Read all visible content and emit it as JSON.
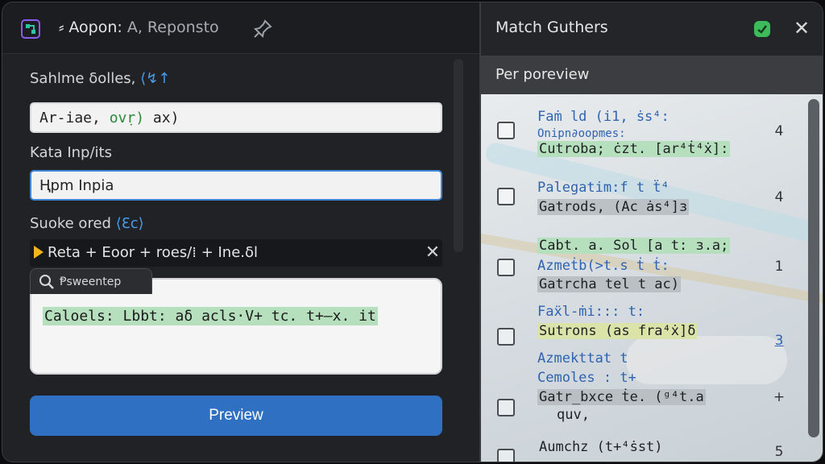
{
  "left": {
    "title": "⸗ Aopon:",
    "title_sub": "A, Reponsto",
    "section1_label": "Sahlme ẟolles,",
    "section1_accent": "⟨↯↑",
    "field1_pre": "Ar-iae,",
    "field1_hl": "ovṛ)",
    "field1_post": "ax)",
    "section2_label": "Kata Inp/its",
    "field2_value": "Ⱨpm Inpia",
    "section3_label": "Suoke ored",
    "section3_accent": "⟨Ɛc⟩",
    "recipe_text": "Reta + Eoor + roes/⁞ + Ine.ẟl",
    "search_label": "Ᵽsweentep",
    "preview_text": "Caloels: Lbbt: aẟ acls·V+ tc. t+–x. it",
    "preview_button": "Preview"
  },
  "right": {
    "title": "Match Guthers",
    "subtitle": "Per poreview",
    "rows": [
      {
        "blue1": "Faṁ ld (i1, ṡs⁴:",
        "blue2": "Onipn∂oopmes:",
        "hl": "Cutroba; ċzt. [ar⁴ṫ⁴ẋ]:",
        "hl_style": "green",
        "count": "4"
      },
      {
        "blue1": "Palegatim:f t ẗ⁴",
        "hl": "Gatrods, (Ac ȧs⁴]ɜ",
        "hl_style": "gray",
        "count": "4"
      },
      {
        "hl_top": "Cabt. a. Sol [a t: ɜ.a;",
        "blue1": "Azmeṫb(>t.s ṫ ṫ:",
        "hl": "Gatrcha tel t ac)",
        "hl_style": "gray",
        "count": "1"
      },
      {
        "blue1": "Faẍl‑ṁi::: t:",
        "hl": "Sutrons (as fra⁴ẋ]ẟ",
        "hl_style": "yellow",
        "count": "3"
      },
      {
        "blue1": "Azmekttat t",
        "blue2": "Cemoles : t+",
        "hl": "Gatr_bxce ṫe. (ᵍ⁴t.a",
        "hl2": "quv,",
        "hl_style": "gray",
        "count": "+"
      },
      {
        "hl": "Aumchz (t+⁴ṡst)",
        "hl_style": "plain",
        "count": "5"
      }
    ]
  },
  "colors": {
    "accent_blue": "#2f70c3",
    "link_blue": "#2f63b0",
    "highlight_green": "#b6e0bd",
    "status_green": "#3dbb5b"
  },
  "icons": [
    "app-icon",
    "pin-icon",
    "search-icon",
    "close-icon",
    "status-check-icon",
    "play-arrow-icon"
  ]
}
